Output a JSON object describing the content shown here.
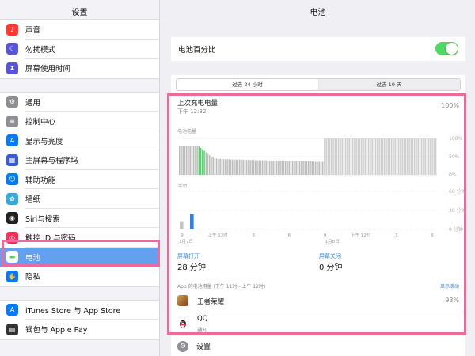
{
  "sidebar": {
    "title": "设置",
    "groups": [
      [
        {
          "label": "声音",
          "icon": "speaker-icon",
          "color": "#ff3b30"
        },
        {
          "label": "勿扰模式",
          "icon": "moon-icon",
          "color": "#5856d6"
        },
        {
          "label": "屏幕使用时间",
          "icon": "hourglass-icon",
          "color": "#5856d6"
        }
      ],
      [
        {
          "label": "通用",
          "icon": "gear-icon",
          "color": "#8e8e93"
        },
        {
          "label": "控制中心",
          "icon": "sliders-icon",
          "color": "#8e8e93"
        },
        {
          "label": "显示与亮度",
          "icon": "text-size-icon",
          "color": "#007aff"
        },
        {
          "label": "主屏幕与程序坞",
          "icon": "grid-icon",
          "color": "#3a5bd9"
        },
        {
          "label": "辅助功能",
          "icon": "accessibility-icon",
          "color": "#007aff"
        },
        {
          "label": "墙纸",
          "icon": "flower-icon",
          "color": "#34aadc"
        },
        {
          "label": "Siri与搜索",
          "icon": "siri-icon",
          "color": "#222222"
        },
        {
          "label": "触控 ID 与密码",
          "icon": "fingerprint-icon",
          "color": "#ff2d55"
        },
        {
          "label": "电池",
          "icon": "battery-icon",
          "color": "#4cd964",
          "active": true
        },
        {
          "label": "隐私",
          "icon": "hand-icon",
          "color": "#007aff"
        }
      ],
      [
        {
          "label": "iTunes Store 与 App Store",
          "icon": "app-store-icon",
          "color": "#007aff"
        },
        {
          "label": "钱包与 Apple Pay",
          "icon": "wallet-icon",
          "color": "#333333"
        }
      ]
    ]
  },
  "main": {
    "title": "电池",
    "battery_percentage_label": "电池百分比",
    "battery_percentage_on": true,
    "tabs": [
      {
        "label": "过去 24 小时",
        "selected": true
      },
      {
        "label": "过去 10 天",
        "selected": false
      }
    ],
    "last_charge": {
      "title": "上次充电电量",
      "time": "下午 12:32",
      "value": "100%"
    },
    "battery_level_label": "电池电量",
    "activity_label": "活动",
    "level_ticks": [
      "100%",
      "50%",
      "0%"
    ],
    "activity_ticks": [
      "60 分钟",
      "30 分钟",
      "0 分钟"
    ],
    "x_ticks": [
      "9",
      "上午 12时",
      "3",
      "6",
      "9",
      "下午 12时",
      "3",
      "6"
    ],
    "x_dates": [
      "1月7日",
      "1月8日"
    ],
    "screen_on": {
      "label": "屏幕打开",
      "value": "28 分钟"
    },
    "screen_off": {
      "label": "屏幕关闭",
      "value": "0 分钟"
    },
    "usage_header": "App 的电池用量 (下午 11时 - 上午 12时)",
    "show_activity": "显示活动",
    "apps": [
      {
        "name": "王者荣耀",
        "value": "98%",
        "sub": ""
      },
      {
        "name": "QQ",
        "value": "",
        "sub": "通知"
      }
    ],
    "settings_row": "设置"
  },
  "colors": {
    "accent": "#63a0f0",
    "highlight": "#ea6c9c",
    "green": "#4cd964",
    "blue": "#007aff"
  },
  "chart_data": [
    {
      "type": "bar",
      "title": "电池电量",
      "y_ticks": [
        "100%",
        "50%",
        "0%"
      ],
      "ylim": [
        0,
        100
      ],
      "values": [
        80,
        80,
        80,
        80,
        80,
        80,
        80,
        80,
        80,
        80,
        80,
        78,
        74,
        70,
        66,
        62,
        58,
        54,
        50,
        48,
        46,
        45,
        44,
        44,
        44,
        43,
        43,
        43,
        43,
        42,
        42,
        42,
        42,
        42,
        42,
        42,
        42,
        41,
        41,
        41,
        41,
        41,
        41,
        40,
        40,
        40,
        40,
        40,
        40,
        40,
        40,
        39,
        39,
        39,
        39,
        39,
        39,
        39,
        39,
        38,
        38,
        38,
        38,
        38,
        38,
        38,
        38,
        38,
        37,
        37,
        37,
        37,
        37,
        37,
        37,
        37,
        36,
        36,
        36,
        36,
        36,
        36,
        100,
        100,
        100,
        100,
        100,
        100,
        100,
        100,
        100,
        100,
        100,
        100,
        100,
        100,
        100,
        100,
        100,
        100,
        100,
        100,
        100,
        100,
        100,
        100,
        100,
        100,
        100,
        100,
        100,
        100,
        100,
        100,
        100,
        100,
        100,
        100,
        100,
        100,
        100,
        100,
        100,
        100,
        100,
        100,
        100,
        100,
        100,
        100,
        100,
        100,
        100,
        100,
        100,
        100,
        100,
        100,
        100,
        100,
        100,
        100,
        100,
        100,
        100,
        100
      ],
      "charging_indices": [
        11,
        12,
        13,
        14
      ]
    },
    {
      "type": "bar",
      "title": "活动",
      "y_ticks": [
        "60 分钟",
        "30 分钟",
        "0 分钟"
      ],
      "ylim": [
        0,
        60
      ],
      "values": [
        13,
        0,
        0,
        0,
        0,
        0,
        0,
        0,
        0,
        0,
        0,
        0,
        0,
        0,
        0,
        0,
        0,
        0,
        0,
        0,
        0,
        0,
        0,
        0,
        0,
        0,
        0,
        0,
        0,
        0,
        0,
        0,
        0,
        0,
        0,
        0,
        0,
        0,
        0,
        0,
        0,
        0,
        0,
        0,
        0,
        0,
        0,
        0,
        0,
        0
      ],
      "screen_on_values": [
        0,
        0,
        24,
        0,
        0,
        0,
        0,
        0,
        0,
        0,
        0,
        0,
        0,
        0,
        0,
        0,
        0,
        0,
        0,
        0,
        0,
        0,
        0,
        0,
        0,
        0,
        0,
        0,
        0,
        0,
        0,
        0,
        0,
        0,
        0,
        0,
        0,
        0,
        0,
        0,
        0,
        0,
        0,
        0,
        0,
        0,
        0,
        0,
        0,
        0
      ],
      "x_ticks": [
        "9",
        "上午 12时",
        "3",
        "6",
        "9",
        "下午 12时",
        "3",
        "6"
      ]
    }
  ]
}
